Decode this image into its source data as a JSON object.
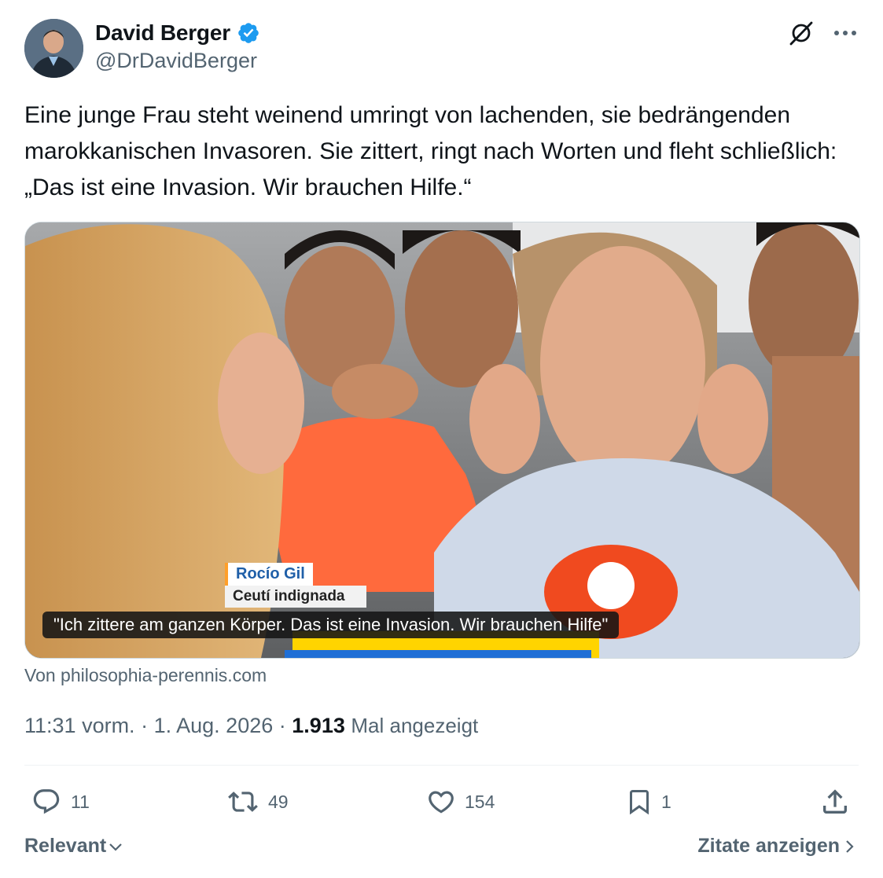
{
  "author": {
    "display_name": "David Berger",
    "handle": "@DrDavidBerger",
    "verified": true,
    "verified_color": "#1d9bf0"
  },
  "tweet": {
    "text": "Eine junge Frau steht weinend umringt von lachenden, sie bedrängenden marokkanischen Invasoren. Sie zittert, ringt nach Worten und fleht schließlich: „Das ist eine Invasion. Wir brauchen Hilfe.“",
    "media": {
      "lower_third_name": "Rocío Gil",
      "lower_third_subtitle": "Ceutí indignada",
      "caption": "\"Ich zittere am ganzen Körper. Das ist eine Invasion. Wir brauchen Hilfe\""
    },
    "source": "Von philosophia-perennis.com",
    "time": "11:31 vorm.",
    "separator": "·",
    "date": "1. Aug. 2026",
    "views_count": "1.913",
    "views_label": "Mal angezeigt"
  },
  "actions": {
    "replies": "11",
    "reposts": "49",
    "likes": "154",
    "bookmarks": "1"
  },
  "footer": {
    "sort_label": "Relevant",
    "quotes_label": "Zitate anzeigen"
  },
  "icons": {
    "grok": "grok-icon",
    "more": "more-icon",
    "reply": "reply-icon",
    "repost": "repost-icon",
    "like": "heart-icon",
    "bookmark": "bookmark-icon",
    "share": "share-icon"
  }
}
